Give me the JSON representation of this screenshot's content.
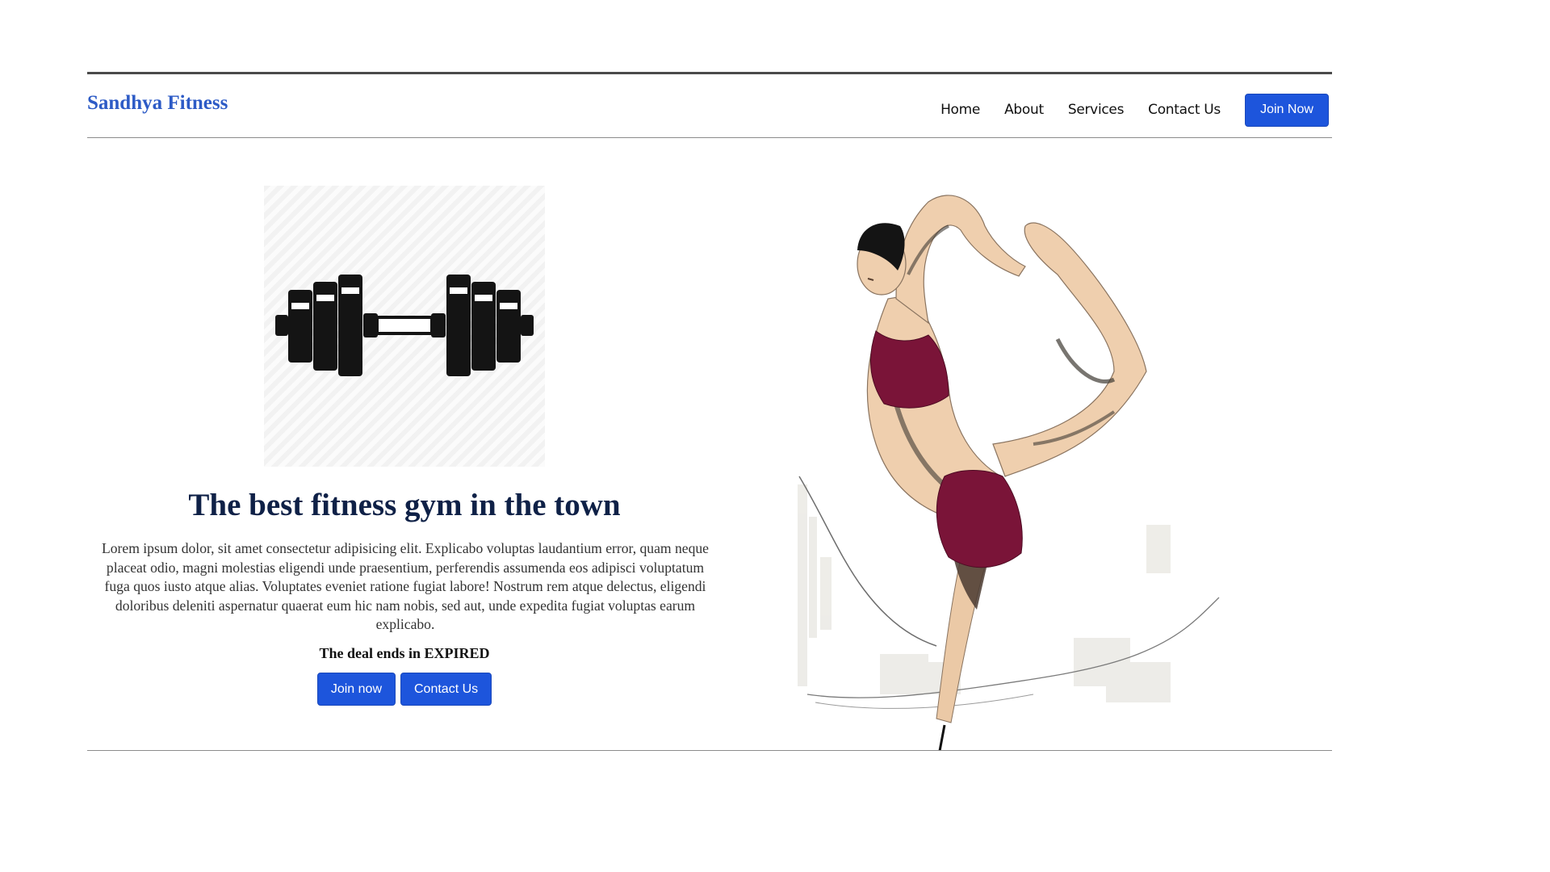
{
  "header": {
    "brand": "Sandhya Fitness",
    "nav": [
      "Home",
      "About",
      "Services",
      "Contact Us"
    ],
    "join_button": "Join Now"
  },
  "hero": {
    "headline": "The best fitness gym in the town",
    "paragraph": "Lorem ipsum dolor, sit amet consectetur adipisicing elit. Explicabo voluptas laudantium error, quam neque placeat odio, magni molestias eligendi unde praesentium, perferendis assumenda eos adipisci voluptatum fuga quos iusto atque alias. Voluptates eveniet ratione fugiat labore! Nostrum rem atque delectus, eligendi doloribus deleniti aspernatur quaerat eum hic nam nobis, sed aut, unde expedita fugiat voluptas earum explicabo.",
    "deal_text": "The deal ends in EXPIRED",
    "join_button": "Join now",
    "contact_button": "Contact Us"
  },
  "icons": {
    "logo": "dumbbell-icon",
    "illustration": "dancer-pose-illustration"
  },
  "colors": {
    "brand": "#2d5bc6",
    "button": "#1d55dc",
    "headline": "#0f2147",
    "outfit": "#7a1438",
    "skin": "#efcfae"
  }
}
